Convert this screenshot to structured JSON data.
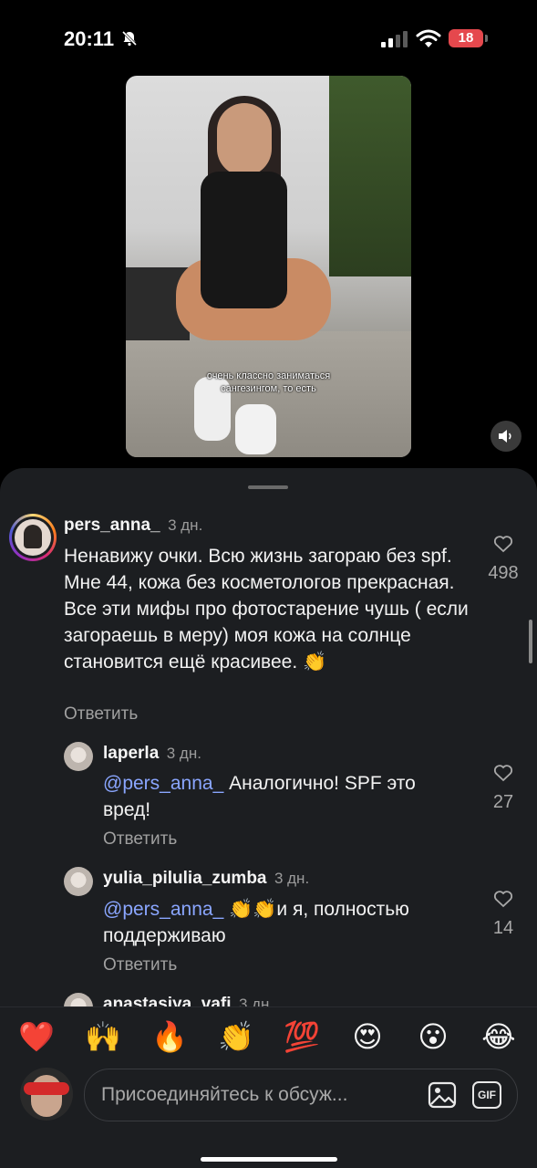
{
  "status_bar": {
    "time": "20:11",
    "battery": "18"
  },
  "video": {
    "subtitle_line1": "очень классно заниматься",
    "subtitle_line2": "сангезингом, то есть"
  },
  "comments": [
    {
      "username": "pers_anna_",
      "time": "3 дн.",
      "text": "Ненавижу очки. Всю жизнь загораю без spf. Мне 44, кожа без косметологов прекрасная. Все эти мифы про фотостарение чушь ( если загораешь в меру) моя кожа на солнце становится ещё красивее. 👏",
      "reply_label": "Ответить",
      "likes": "498"
    },
    {
      "username": "laperla",
      "time": "3 дн.",
      "mention": "@pers_anna_",
      "text": "Аналогично! SPF это вред!",
      "reply_label": "Ответить",
      "likes": "27"
    },
    {
      "username": "yulia_pilulia_zumba",
      "time": "3 дн.",
      "mention": "@pers_anna_",
      "text": "👏👏и я, полностью поддерживаю",
      "reply_label": "Ответить",
      "likes": "14"
    },
    {
      "username": "anastasiya_vafi",
      "time": "3 дн."
    }
  ],
  "emoji_bar": [
    "❤️",
    "🙌",
    "🔥",
    "👏",
    "💯",
    "😍",
    "😮",
    "😂"
  ],
  "input": {
    "placeholder": "Присоединяйтесь к обсуж...",
    "gif_label": "GIF"
  }
}
